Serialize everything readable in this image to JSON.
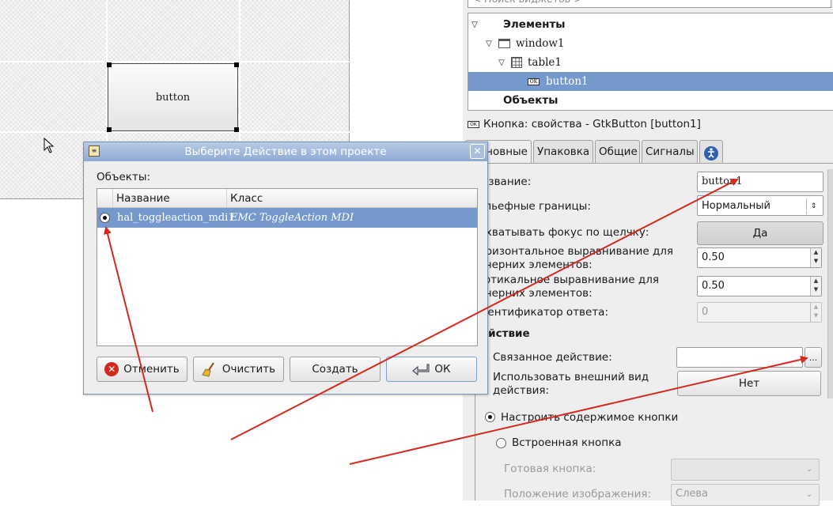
{
  "canvas": {
    "button_label": "button"
  },
  "dialog": {
    "title": "Выберите Действие в этом проекте",
    "objects_label": "Объекты:",
    "columns": [
      "Название",
      "Класс"
    ],
    "rows": [
      {
        "name": "hal_toggleaction_mdi1",
        "class": "EMC ToggleAction MDI"
      }
    ],
    "buttons": {
      "cancel": "Отменить",
      "clear": "Очистить",
      "create": "Создать",
      "ok": "ОК"
    }
  },
  "tree": {
    "search_placeholder": "< Поиск виджетов >",
    "items": [
      "Элементы",
      "window1",
      "table1",
      "button1",
      "Объекты"
    ]
  },
  "props": {
    "title": "Кнопка: свойства - GtkButton [button1]",
    "tabs": [
      "Основные",
      "Упаковка",
      "Общие",
      "Сигналы"
    ],
    "name_label": "Название:",
    "name_value": "button1",
    "relief_label": "Рельефные границы:",
    "relief_value": "Нормальный",
    "focus_label": "Захватывать фокус по щелчку:",
    "focus_value": "Да",
    "halign_label_1": "Горизонтальное выравнивание для",
    "halign_label_2": "дочерних элементов:",
    "halign_value": "0.50",
    "valign_label_1": "Вертикальное выравнивание для",
    "valign_label_2": "дочерних элементов:",
    "valign_value": "0.50",
    "response_label": "Идентификатор ответа:",
    "response_value": "0",
    "action_header": "Действие",
    "related_action_label": "Связанное действие:",
    "related_action_value": "",
    "ellipsis": "...",
    "use_action_appearance_1": "Использовать внешний вид",
    "use_action_appearance_2": "действия:",
    "use_action_value": "Нет",
    "custom_content": "Настроить содержимое кнопки",
    "stock_button": "Встроенная кнопка",
    "ready_button_label": "Готовая кнопка:",
    "image_position_label": "Положение изображения:",
    "image_position_value": "Слева"
  },
  "colors": {
    "selection": "#7599cd",
    "arrow": "#d42a1e"
  }
}
